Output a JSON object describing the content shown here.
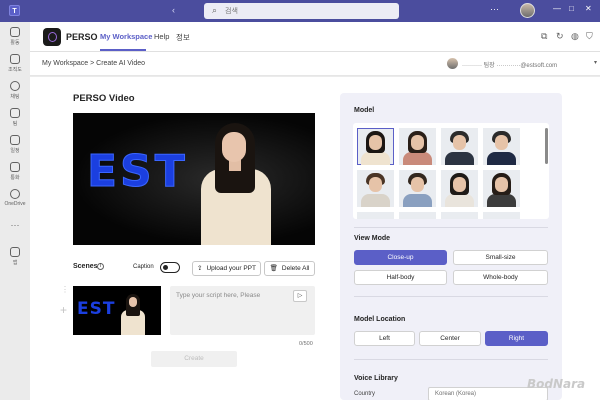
{
  "titlebar": {
    "search_placeholder": "검색",
    "nav": "‹ ›",
    "more": "···",
    "minimize": "—",
    "maximize": "□",
    "close": "✕"
  },
  "rail": [
    {
      "label": "활동",
      "icon": "bell-icon"
    },
    {
      "label": "조직도",
      "icon": "org-icon"
    },
    {
      "label": "채팅",
      "icon": "chat-icon"
    },
    {
      "label": "팀",
      "icon": "teams-icon"
    },
    {
      "label": "일정",
      "icon": "calendar-icon"
    },
    {
      "label": "통화",
      "icon": "phone-icon"
    },
    {
      "label": "OneDrive",
      "icon": "cloud-icon"
    },
    {
      "label": "···",
      "icon": "more-icon"
    },
    {
      "label": "앱",
      "icon": "apps-icon"
    }
  ],
  "app": {
    "name": "PERSO",
    "tabs": [
      {
        "label": "My Workspace",
        "active": true
      },
      {
        "label": "Help",
        "active": false
      },
      {
        "label": "정보",
        "active": false
      }
    ]
  },
  "breadcrumb": {
    "path": "My Workspace  >  Create AI Video",
    "user": "·········· 팀장  ············@estsoft.com"
  },
  "editor": {
    "title": "PERSO Video",
    "preview_text": "EST",
    "scenes_label": "Scenes",
    "caption_label": "Caption",
    "caption_on": false,
    "upload_label": "Upload your PPT",
    "delete_label": "Delete All",
    "thumb_text": "EST",
    "script_placeholder": "Type your script here, Please",
    "char_count": "0/500",
    "create_label": "Create"
  },
  "panel": {
    "model_title": "Model",
    "models": [
      {
        "hair": "#1c1714",
        "body": "#efe3cf",
        "selected": true
      },
      {
        "hair": "#2a1f18",
        "body": "#c98a7a",
        "selected": false
      },
      {
        "hair": "#2b2b2b",
        "body": "#2c3442",
        "selected": false
      },
      {
        "hair": "#2a2a2a",
        "body": "#1f2a44",
        "selected": false
      },
      {
        "hair": "#4a3526",
        "body": "#d9d3c9",
        "selected": false
      },
      {
        "hair": "#33281f",
        "body": "#8aa0c0",
        "selected": false
      },
      {
        "hair": "#1e1a17",
        "body": "#e9e4dc",
        "selected": false
      },
      {
        "hair": "#261d17",
        "body": "#3c3c3c",
        "selected": false
      }
    ],
    "view_mode_title": "View Mode",
    "view_modes": [
      {
        "label": "Close-up",
        "active": true
      },
      {
        "label": "Small-size",
        "active": false
      },
      {
        "label": "Half-body",
        "active": false
      },
      {
        "label": "Whole-body",
        "active": false
      }
    ],
    "location_title": "Model Location",
    "locations": [
      {
        "label": "Left",
        "active": false
      },
      {
        "label": "Center",
        "active": false
      },
      {
        "label": "Right",
        "active": true
      }
    ],
    "voice_title": "Voice Library",
    "voice_country_label": "Country",
    "voice_country_value": "Korean (Korea)"
  },
  "watermark": "BodNara"
}
